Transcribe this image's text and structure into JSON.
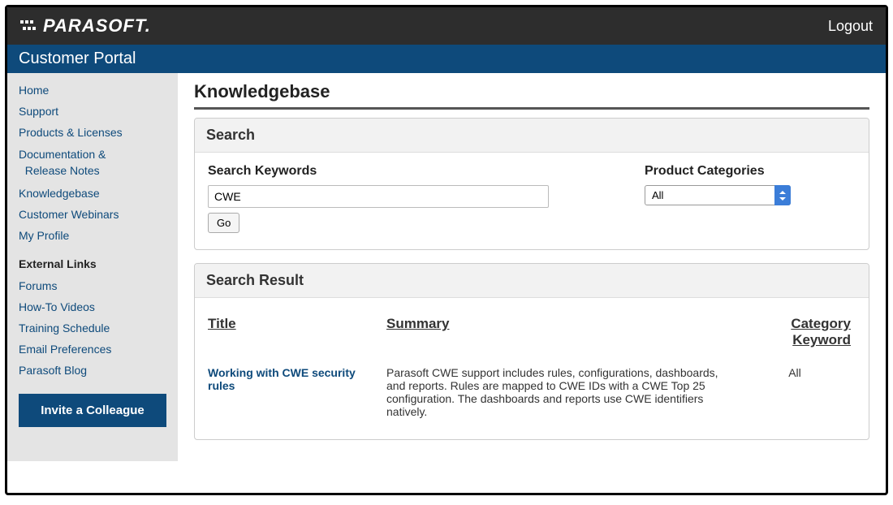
{
  "header": {
    "brand": "PARASOFT.",
    "logout": "Logout"
  },
  "subheader": {
    "title": "Customer Portal"
  },
  "sidebar": {
    "nav": [
      "Home",
      "Support",
      "Products & Licenses",
      "Documentation &\n  Release Notes",
      "Knowledgebase",
      "Customer Webinars",
      "My Profile"
    ],
    "external_heading": "External Links",
    "external": [
      "Forums",
      "How-To Videos",
      "Training Schedule",
      "Email Preferences",
      "Parasoft Blog"
    ],
    "invite_label": "Invite a Colleague"
  },
  "main": {
    "page_title": "Knowledgebase",
    "search_panel": {
      "title": "Search",
      "keywords_label": "Search Keywords",
      "keywords_value": "CWE",
      "go_label": "Go",
      "categories_label": "Product Categories",
      "category_selected": "All"
    },
    "result_panel": {
      "title": "Search Result",
      "columns": {
        "title": "Title",
        "summary": "Summary",
        "category": "Category Keyword"
      },
      "rows": [
        {
          "title": "Working with CWE security rules",
          "summary": "Parasoft CWE support includes rules, configurations, dashboards, and reports. Rules are mapped to CWE IDs with a CWE Top 25 configuration. The dashboards and reports use CWE identifiers natively.",
          "category": "All"
        }
      ]
    }
  }
}
